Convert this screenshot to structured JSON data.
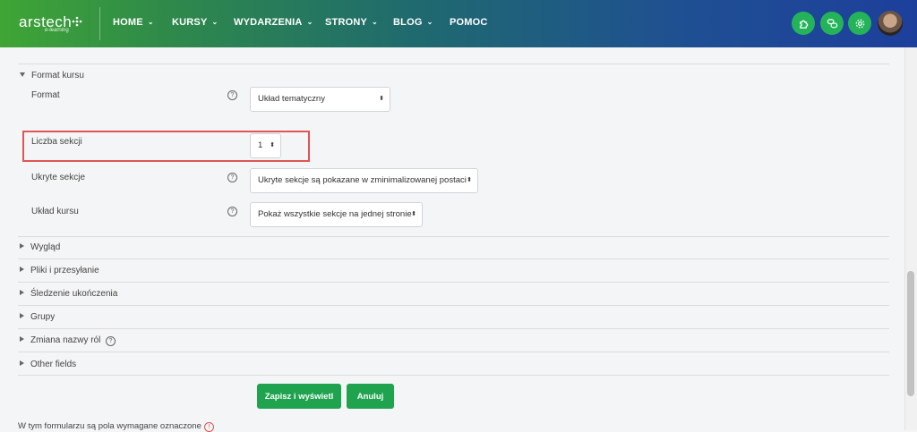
{
  "nav": {
    "logo_text": "arstech",
    "logo_sub": "e-learning",
    "items": [
      {
        "label": "HOME",
        "has_dropdown": true
      },
      {
        "label": "KURSY",
        "has_dropdown": true
      },
      {
        "label": "WYDARZENIA",
        "has_dropdown": true
      },
      {
        "label": "STRONY",
        "has_dropdown": true
      },
      {
        "label": "BLOG",
        "has_dropdown": true
      },
      {
        "label": "POMOC",
        "has_dropdown": false
      }
    ],
    "chevron": "⌄",
    "icons": [
      "puzzle-icon",
      "chat-icon",
      "gear-icon"
    ],
    "accent_color": "#25b35a"
  },
  "form": {
    "format_section": "Format kursu",
    "fields": {
      "format": {
        "label": "Format",
        "value": "Układ tematyczny"
      },
      "sections": {
        "label": "Liczba sekcji",
        "value": "1"
      },
      "hidden_sections": {
        "label": "Ukryte sekcje",
        "value": "Ukryte sekcje są pokazane w zminimalizowanej postaci"
      },
      "layout": {
        "label": "Układ kursu",
        "value": "Pokaż wszystkie sekcje na jednej stronie"
      }
    },
    "collapsed_sections": [
      "Wygląd",
      "Pliki i przesyłanie",
      "Śledzenie ukończenia",
      "Grupy",
      "Zmiana nazwy ról",
      "Other fields"
    ],
    "help_glyph": "?",
    "select_arrow": "⬍",
    "buttons": {
      "save": "Zapisz i wyświetl",
      "cancel": "Anuluj"
    },
    "required_note": "W tym formularzu są pola wymagane oznaczone",
    "required_glyph": "!"
  }
}
